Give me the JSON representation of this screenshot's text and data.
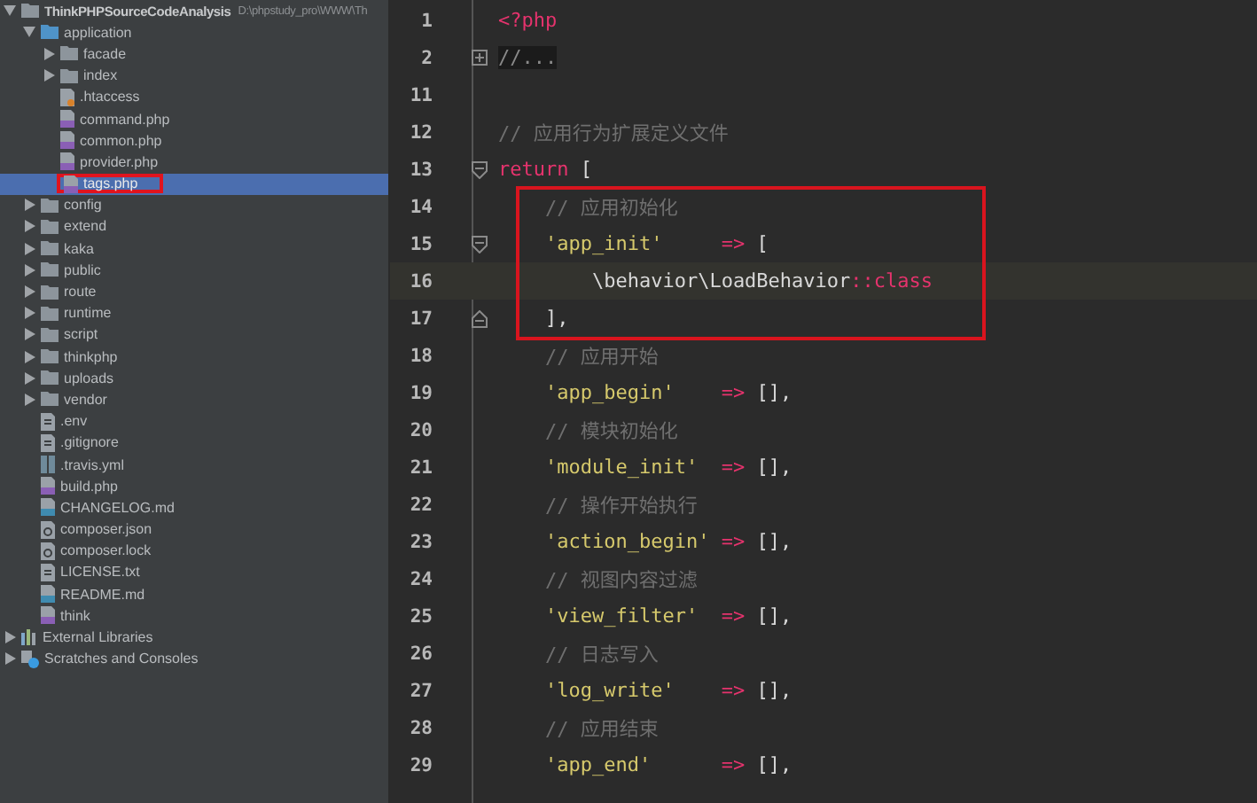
{
  "project_tree": {
    "items": [
      {
        "kind": "project",
        "label": "ThinkPHPSourceCodeAnalysis",
        "path": "D:\\phpstudy_pro\\WWW\\Th",
        "expanded": true,
        "selected": false,
        "highlighted": false,
        "children": [
          {
            "kind": "source-folder",
            "label": "application",
            "expanded": true,
            "selected": false,
            "highlighted": false,
            "children": [
              {
                "kind": "folder",
                "label": "facade",
                "expanded": false,
                "selected": false,
                "highlighted": false
              },
              {
                "kind": "folder",
                "label": "index",
                "expanded": false,
                "selected": false,
                "highlighted": false
              },
              {
                "kind": "htaccess",
                "label": ".htaccess",
                "selected": false,
                "highlighted": false
              },
              {
                "kind": "php",
                "label": "command.php",
                "selected": false,
                "highlighted": false
              },
              {
                "kind": "php",
                "label": "common.php",
                "selected": false,
                "highlighted": false
              },
              {
                "kind": "php",
                "label": "provider.php",
                "selected": false,
                "highlighted": false
              },
              {
                "kind": "php",
                "label": "tags.php",
                "selected": true,
                "highlighted": true
              }
            ]
          },
          {
            "kind": "folder",
            "label": "config",
            "expanded": false,
            "selected": false,
            "highlighted": false
          },
          {
            "kind": "folder",
            "label": "extend",
            "expanded": false,
            "selected": false,
            "highlighted": false
          },
          {
            "kind": "folder",
            "label": "kaka",
            "expanded": false,
            "selected": false,
            "highlighted": false
          },
          {
            "kind": "folder",
            "label": "public",
            "expanded": false,
            "selected": false,
            "highlighted": false
          },
          {
            "kind": "folder",
            "label": "route",
            "expanded": false,
            "selected": false,
            "highlighted": false
          },
          {
            "kind": "folder",
            "label": "runtime",
            "expanded": false,
            "selected": false,
            "highlighted": false
          },
          {
            "kind": "folder",
            "label": "script",
            "expanded": false,
            "selected": false,
            "highlighted": false
          },
          {
            "kind": "folder",
            "label": "thinkphp",
            "expanded": false,
            "selected": false,
            "highlighted": false
          },
          {
            "kind": "folder",
            "label": "uploads",
            "expanded": false,
            "selected": false,
            "highlighted": false
          },
          {
            "kind": "folder",
            "label": "vendor",
            "expanded": false,
            "selected": false,
            "highlighted": false
          },
          {
            "kind": "text",
            "label": ".env",
            "selected": false,
            "highlighted": false
          },
          {
            "kind": "text",
            "label": ".gitignore",
            "selected": false,
            "highlighted": false
          },
          {
            "kind": "yml",
            "label": ".travis.yml",
            "selected": false,
            "highlighted": false
          },
          {
            "kind": "php",
            "label": "build.php",
            "selected": false,
            "highlighted": false
          },
          {
            "kind": "markdown",
            "label": "CHANGELOG.md",
            "selected": false,
            "highlighted": false
          },
          {
            "kind": "composer",
            "label": "composer.json",
            "selected": false,
            "highlighted": false
          },
          {
            "kind": "composer",
            "label": "composer.lock",
            "selected": false,
            "highlighted": false
          },
          {
            "kind": "text",
            "label": "LICENSE.txt",
            "selected": false,
            "highlighted": false
          },
          {
            "kind": "markdown",
            "label": "README.md",
            "selected": false,
            "highlighted": false
          },
          {
            "kind": "php",
            "label": "think",
            "selected": false,
            "highlighted": false
          }
        ]
      },
      {
        "kind": "library",
        "label": "External Libraries",
        "expanded": false,
        "selected": false,
        "highlighted": false
      },
      {
        "kind": "scratches",
        "label": "Scratches and Consoles",
        "expanded": false,
        "selected": false,
        "highlighted": false
      }
    ]
  },
  "editor": {
    "lines": [
      {
        "number": "1",
        "kind": "plain",
        "current": false,
        "boxed": false,
        "tokens": [
          {
            "kind": "tag",
            "text": "<?php"
          }
        ]
      },
      {
        "number": "2",
        "kind": "folded",
        "current": false,
        "boxed": false,
        "tokens": [
          {
            "kind": "folded",
            "text": "//..."
          }
        ]
      },
      {
        "number": "11",
        "kind": "plain",
        "current": false,
        "boxed": false
      },
      {
        "number": "12",
        "kind": "plain",
        "current": false,
        "boxed": false,
        "tokens": [
          {
            "kind": "comment",
            "text": "// 应用行为扩展定义文件"
          }
        ]
      },
      {
        "number": "13",
        "kind": "fold-start",
        "current": false,
        "boxed": false,
        "tokens": [
          {
            "kind": "keyword",
            "text": "return "
          },
          {
            "kind": "plain",
            "text": "["
          }
        ]
      },
      {
        "number": "14",
        "kind": "plain",
        "current": false,
        "boxed": true,
        "tokens": [
          {
            "kind": "comment",
            "text": "    // 应用初始化"
          }
        ]
      },
      {
        "number": "15",
        "kind": "fold-start",
        "current": false,
        "boxed": true,
        "tokens": [
          {
            "kind": "string",
            "text": "    'app_init'     "
          },
          {
            "kind": "operator",
            "text": "=> "
          },
          {
            "kind": "plain",
            "text": "["
          }
        ]
      },
      {
        "number": "16",
        "kind": "plain",
        "current": true,
        "boxed": true,
        "tokens": [
          {
            "kind": "plain",
            "text": "        \\behavior\\LoadBehavior"
          },
          {
            "kind": "keyword",
            "text": "::class"
          }
        ]
      },
      {
        "number": "17",
        "kind": "fold-end",
        "current": false,
        "boxed": true,
        "tokens": [
          {
            "kind": "plain",
            "text": "    ],"
          }
        ]
      },
      {
        "number": "18",
        "kind": "plain",
        "current": false,
        "boxed": false,
        "tokens": [
          {
            "kind": "comment",
            "text": "    // 应用开始"
          }
        ]
      },
      {
        "number": "19",
        "kind": "plain",
        "current": false,
        "boxed": false,
        "tokens": [
          {
            "kind": "string",
            "text": "    'app_begin'    "
          },
          {
            "kind": "operator",
            "text": "=> "
          },
          {
            "kind": "plain",
            "text": "[],"
          }
        ]
      },
      {
        "number": "20",
        "kind": "plain",
        "current": false,
        "boxed": false,
        "tokens": [
          {
            "kind": "comment",
            "text": "    // 模块初始化"
          }
        ]
      },
      {
        "number": "21",
        "kind": "plain",
        "current": false,
        "boxed": false,
        "tokens": [
          {
            "kind": "string",
            "text": "    'module_init'  "
          },
          {
            "kind": "operator",
            "text": "=> "
          },
          {
            "kind": "plain",
            "text": "[],"
          }
        ]
      },
      {
        "number": "22",
        "kind": "plain",
        "current": false,
        "boxed": false,
        "tokens": [
          {
            "kind": "comment",
            "text": "    // 操作开始执行"
          }
        ]
      },
      {
        "number": "23",
        "kind": "plain",
        "current": false,
        "boxed": false,
        "tokens": [
          {
            "kind": "string",
            "text": "    'action_begin' "
          },
          {
            "kind": "operator",
            "text": "=> "
          },
          {
            "kind": "plain",
            "text": "[],"
          }
        ]
      },
      {
        "number": "24",
        "kind": "plain",
        "current": false,
        "boxed": false,
        "tokens": [
          {
            "kind": "comment",
            "text": "    // 视图内容过滤"
          }
        ]
      },
      {
        "number": "25",
        "kind": "plain",
        "current": false,
        "boxed": false,
        "tokens": [
          {
            "kind": "string",
            "text": "    'view_filter'  "
          },
          {
            "kind": "operator",
            "text": "=> "
          },
          {
            "kind": "plain",
            "text": "[],"
          }
        ]
      },
      {
        "number": "26",
        "kind": "plain",
        "current": false,
        "boxed": false,
        "tokens": [
          {
            "kind": "comment",
            "text": "    // 日志写入"
          }
        ]
      },
      {
        "number": "27",
        "kind": "plain",
        "current": false,
        "boxed": false,
        "tokens": [
          {
            "kind": "string",
            "text": "    'log_write'    "
          },
          {
            "kind": "operator",
            "text": "=> "
          },
          {
            "kind": "plain",
            "text": "[],"
          }
        ]
      },
      {
        "number": "28",
        "kind": "plain",
        "current": false,
        "boxed": false,
        "tokens": [
          {
            "kind": "comment",
            "text": "    // 应用结束"
          }
        ]
      },
      {
        "number": "29",
        "kind": "plain",
        "current": false,
        "boxed": false,
        "tokens": [
          {
            "kind": "string",
            "text": "    'app_end'      "
          },
          {
            "kind": "operator",
            "text": "=> "
          },
          {
            "kind": "plain",
            "text": "[],"
          }
        ]
      }
    ]
  }
}
